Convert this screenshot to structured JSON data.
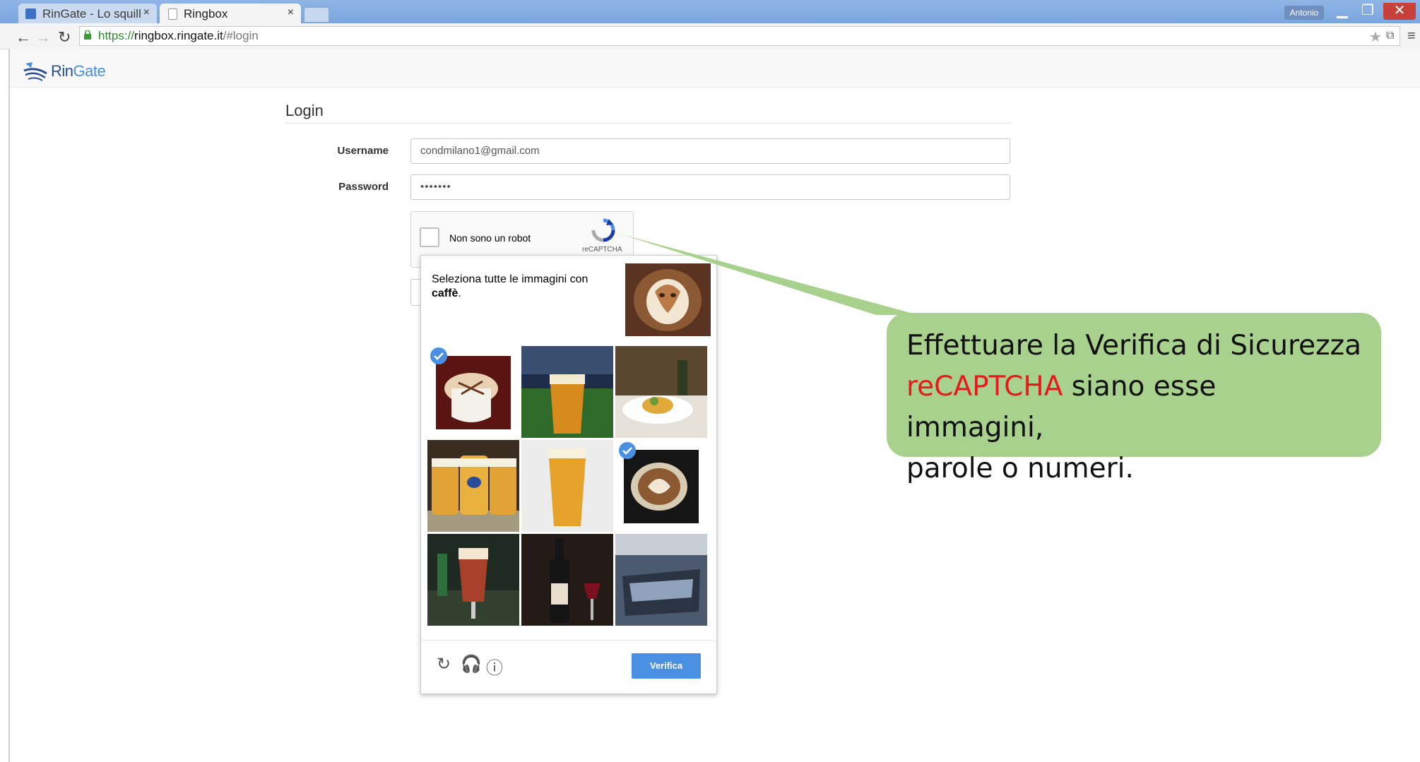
{
  "browser": {
    "tabs": [
      {
        "title": "RinGate - Lo squillo",
        "close": "×"
      },
      {
        "title": "Ringbox",
        "close": "×"
      }
    ],
    "user": "Antonio",
    "url_https": "https://",
    "url_host": "ringbox.ringate.it",
    "url_path": "/#login"
  },
  "app": {
    "logo_part1": "Rin",
    "logo_part2": "Gate"
  },
  "login": {
    "title": "Login",
    "username_label": "Username",
    "username_value": "condmilano1@gmail.com",
    "password_label": "Password",
    "password_value": "•••••••"
  },
  "recaptcha": {
    "checkbox_label": "Non sono un robot",
    "brand": "reCAPTCHA",
    "instruction": "Seleziona tutte le immagini con",
    "keyword": "caffè",
    "instruction_end": ".",
    "verify_label": "Verifica",
    "tiles": [
      {
        "subject": "coffee-mocha",
        "selected": true
      },
      {
        "subject": "beer-stadium",
        "selected": false
      },
      {
        "subject": "food-plate",
        "selected": false
      },
      {
        "subject": "beer-mugs",
        "selected": false
      },
      {
        "subject": "beer-glass",
        "selected": false
      },
      {
        "subject": "coffee-latte-art",
        "selected": true
      },
      {
        "subject": "beer-pint",
        "selected": false
      },
      {
        "subject": "wine-bottle",
        "selected": false
      },
      {
        "subject": "frozen-scene",
        "selected": false
      }
    ]
  },
  "callout": {
    "line1": "Effettuare la Verifica di Sicurezza",
    "highlight": "reCAPTCHA",
    "line2_rest": " siano esse immagini,",
    "line3": "parole o numeri.",
    "highlight_color": "#e8191a",
    "bg_color": "#a9d18e"
  }
}
